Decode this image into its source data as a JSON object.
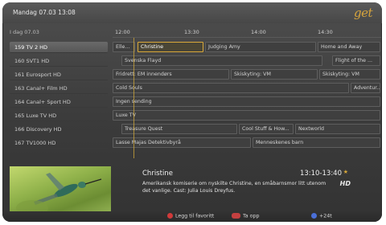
{
  "header": {
    "datetime": "Mandag 07.03 13:08",
    "logo": "get",
    "today_label": "I dag 07.03"
  },
  "times": [
    "12:00",
    "13:30",
    "14:00",
    "14:30"
  ],
  "channels": [
    "159 TV 2 HD",
    "160 SVT1 HD",
    "161 Eurosport HD",
    "163 Canal+ Film HD",
    "164 Canal+ Sport HD",
    "165 Luxe TV HD",
    "166 Discovery HD",
    "167 TV1000 HD"
  ],
  "programs": [
    {
      "row": 0,
      "items": [
        {
          "title": "Elle..."
        },
        {
          "title": "Christine",
          "highlight": true
        },
        {
          "title": "Judging Amy"
        },
        {
          "title": "Home and Away"
        }
      ]
    },
    {
      "row": 1,
      "items": [
        {
          "title": "Svenska Flayd"
        },
        {
          "title": "Flight of the ..."
        }
      ]
    },
    {
      "row": 2,
      "items": [
        {
          "title": "Fridrett: EM innendørs"
        },
        {
          "title": "Skiskyting: VM"
        },
        {
          "title": "Skiskyting: VM"
        }
      ]
    },
    {
      "row": 3,
      "items": [
        {
          "title": "Cold Souls"
        },
        {
          "title": "Adventur..."
        }
      ]
    },
    {
      "row": 4,
      "items": [
        {
          "title": "Ingen sending"
        }
      ]
    },
    {
      "row": 5,
      "items": [
        {
          "title": "Luxe TV"
        }
      ]
    },
    {
      "row": 6,
      "items": [
        {
          "title": "Treasure Quest"
        },
        {
          "title": "Cool Stuff & How..."
        },
        {
          "title": "Nextworld"
        }
      ]
    },
    {
      "row": 7,
      "items": [
        {
          "title": "Lasse Majas Detektivbyrå"
        },
        {
          "title": "Menneskenes barn"
        }
      ]
    }
  ],
  "info": {
    "title": "Christine",
    "time": "13:10-13:40",
    "badge": "HD",
    "description": "Amerikansk komiserie om nyskilte Christine, en småbarnsmor litt utenom det vanlige. Cast: Julia Louis Dreyfus."
  },
  "footer": {
    "fav_label": "Legg til favoritt",
    "rec_label": "Ta opp",
    "plus_label": "+24t",
    "fav_color": "#d13a3a",
    "rec_color": "#c44040",
    "plus_color": "#4a6fd8"
  }
}
